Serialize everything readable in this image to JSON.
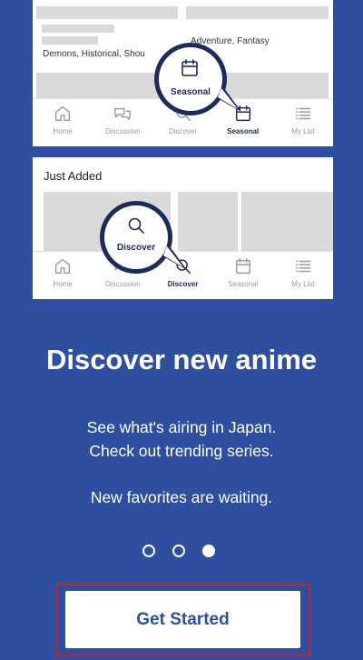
{
  "card_top": {
    "text_genres_left": "Demons, Historical, Shou",
    "text_genres_right": "Adventure, Fantasy",
    "callout_label": "Seasonal",
    "callout_icon": "calendar-icon"
  },
  "card_bottom": {
    "section_title": "Just Added",
    "callout_label": "Discover",
    "callout_icon": "search-icon"
  },
  "tabs": [
    {
      "label": "Home",
      "icon": "home-icon"
    },
    {
      "label": "Discussion",
      "icon": "chat-icon"
    },
    {
      "label": "Discover",
      "icon": "search-icon"
    },
    {
      "label": "Seasonal",
      "icon": "calendar-icon"
    },
    {
      "label": "My List",
      "icon": "list-icon"
    }
  ],
  "onboarding": {
    "heading": "Discover new anime",
    "line1": "See what's airing in Japan.",
    "line2": "Check out trending series.",
    "line3": "New favorites are waiting.",
    "page_count": 3,
    "active_page": 3,
    "cta_label": "Get Started"
  },
  "colors": {
    "background": "#2e4e9f",
    "accent": "#1c2b57",
    "highlight_outline": "#c8202f"
  }
}
